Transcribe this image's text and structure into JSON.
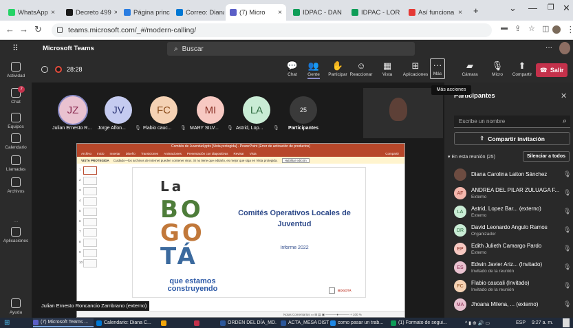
{
  "browser": {
    "tabs": [
      {
        "label": "WhatsApp",
        "color": "#25d366"
      },
      {
        "label": "Decreto 499",
        "color": "#1a1a1a"
      },
      {
        "label": "Página princ",
        "color": "#2a7de1"
      },
      {
        "label": "Correo: Diana",
        "color": "#0078d4"
      },
      {
        "label": "(7) Micro",
        "color": "#5b5fc7"
      },
      {
        "label": "IDPAC - DAN",
        "color": "#0f9d58"
      },
      {
        "label": "IDPAC - LOR",
        "color": "#0f9d58"
      },
      {
        "label": "Así funciona",
        "color": "#e53935"
      }
    ],
    "new_tab": "+",
    "url": "teams.microsoft.com/_#/modern-calling/"
  },
  "teams": {
    "app_name": "Microsoft Teams",
    "search_placeholder": "Buscar",
    "more": "···"
  },
  "rail": [
    {
      "label": "Actividad",
      "icon": "bell-icon"
    },
    {
      "label": "Chat",
      "icon": "chat-icon",
      "badge": "7"
    },
    {
      "label": "Equipos",
      "icon": "teams-icon"
    },
    {
      "label": "Calendario",
      "icon": "calendar-icon"
    },
    {
      "label": "Llamadas",
      "icon": "phone-icon"
    },
    {
      "label": "Archivos",
      "icon": "file-icon"
    },
    {
      "label": "···",
      "icon": "more-icon"
    },
    {
      "label": "Aplicaciones",
      "icon": "apps-icon"
    },
    {
      "label": "Ayuda",
      "icon": "help-icon"
    }
  ],
  "meeting": {
    "timer": "28:28",
    "toolbar": [
      {
        "label": "Chat",
        "glyph": "💬"
      },
      {
        "label": "Gente",
        "glyph": "👥",
        "selected": true
      },
      {
        "label": "Participar",
        "glyph": "✋"
      },
      {
        "label": "Reaccionar",
        "glyph": "☺"
      },
      {
        "label": "Vista",
        "glyph": "▦"
      },
      {
        "label": "Aplicaciones",
        "glyph": "⊞"
      },
      {
        "label": "Más",
        "glyph": "···"
      },
      {
        "label": "Cámara",
        "glyph": "▰"
      },
      {
        "label": "Micro",
        "glyph": "🎙"
      },
      {
        "label": "Compartir",
        "glyph": "⬆"
      }
    ],
    "leave_label": "Salir",
    "tooltip": "Más acciones",
    "avatars": [
      {
        "initials": "JZ",
        "name": "Julian Ernesto R...",
        "bg": "#e9c2d0",
        "fg": "#8a2a50"
      },
      {
        "initials": "JV",
        "name": "Jorge Alfon...",
        "bg": "#c5cbf0",
        "fg": "#2c3576"
      },
      {
        "initials": "FC",
        "name": "Flabio cauc...",
        "bg": "#f5d2b4",
        "fg": "#8a4b1a"
      },
      {
        "initials": "MI",
        "name": "MARY SILV...",
        "bg": "#f7c9c2",
        "fg": "#8a3025"
      },
      {
        "initials": "LA",
        "name": "Astrid, Lop...",
        "bg": "#c9ecd5",
        "fg": "#2d6b3f"
      }
    ],
    "participants_count": "25",
    "participants_label": "Participantes",
    "caption": "Julian Ernesto Roncancio Zambrano (externo)"
  },
  "ppt": {
    "window_title": "Comités de Juventud.pptx [Vista protegida] - PowerPoint (Error de activación de productos)",
    "ribbon": [
      "Archivo",
      "Inicio",
      "Insertar",
      "Diseño",
      "Transiciones",
      "Animaciones",
      "Presentación con diapositivas",
      "Revisar",
      "Vista"
    ],
    "share": "Compartir",
    "warning_tag": "VISTA PROTEGIDA",
    "warning_text": "Cuidado—los archivos de Internet pueden contener virus. Si no tiene que editarlo, es mejor que siga en Vista protegida.",
    "warning_button": "Habilitar edición",
    "thumbs": [
      "1",
      "2",
      "3",
      "4",
      "5",
      "6",
      "7",
      "8",
      "9",
      "10"
    ],
    "slide": {
      "logo_lines": [
        "La",
        "BO",
        "GO",
        "TÁ"
      ],
      "logo_tag1": "que estamos",
      "logo_tag2": "construyendo",
      "heading1": "Comités Operativos Locales de",
      "heading2": "Juventud",
      "subtitle": "Informe 2022",
      "brand": "BOGOTÁ"
    },
    "status": "Notas   Comentarios   ▭  ⊞  ▤  ▣   ─────●─────  + 100 %"
  },
  "panel": {
    "title": "Participantes",
    "search_placeholder": "Escribe un nombre",
    "share_invite": "Compartir invitación",
    "section": "En esta reunión (25)",
    "mute_all": "Silenciar a todos",
    "people": [
      {
        "initials": "",
        "name": "Diana Carolina Laiton Sánchez",
        "sub": "",
        "bg": "#6d4c41",
        "photo": true
      },
      {
        "initials": "AF",
        "name": "ANDREA DEL PILAR ZULUAGA F...",
        "sub": "Externo",
        "bg": "#f4b7ad",
        "fg": "#8a3025"
      },
      {
        "initials": "LA",
        "name": "Astrid, Lopez Bar... (externo)",
        "sub": "Externo",
        "bg": "#c9ecd5",
        "fg": "#2d6b3f"
      },
      {
        "initials": "DR",
        "name": "David Leonardo Angulo Ramos",
        "sub": "Organizador",
        "bg": "#c9ecd5",
        "fg": "#2d6b3f"
      },
      {
        "initials": "EP",
        "name": "Edith Julieth Camargo Pardo",
        "sub": "Externo",
        "bg": "#f7c9c2",
        "fg": "#8a3025"
      },
      {
        "initials": "ES",
        "name": "Edwin Javier Ariz... (Invitado)",
        "sub": "Invitado de la reunión",
        "bg": "#e9c2d0",
        "fg": "#8a2a50"
      },
      {
        "initials": "FC",
        "name": "Flabio caucali (Invitado)",
        "sub": "Invitado de la reunión",
        "bg": "#f5d2b4",
        "fg": "#8a4b1a"
      },
      {
        "initials": "MA",
        "name": "Jhoana Milena, ... (externo)",
        "sub": "",
        "bg": "#e9c2d0",
        "fg": "#8a2a50"
      }
    ]
  },
  "taskbar": {
    "items": [
      {
        "label": "(7) Microsoft Teams ...",
        "color": "#5b5fc7"
      },
      {
        "label": "Calendario: Diana C...",
        "color": "#0078d4"
      },
      {
        "label": "",
        "color": "#f2a60c"
      },
      {
        "label": "",
        "color": "#c4314b"
      },
      {
        "label": "ORDEN DEL DÍA_MD...",
        "color": "#2b579a"
      },
      {
        "label": "ACTA_MESA DISTRIT...",
        "color": "#2b579a"
      },
      {
        "label": "como pasar un trab...",
        "color": "#1e88e5"
      },
      {
        "label": "(1) Formato de segui...",
        "color": "#0f9d58"
      }
    ],
    "lang": "ESP",
    "time": "9:27 a. m."
  }
}
